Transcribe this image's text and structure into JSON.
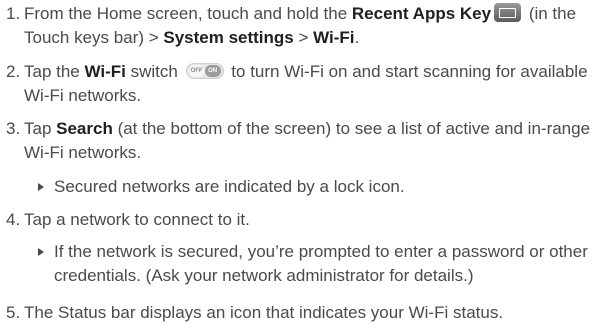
{
  "steps": [
    {
      "number": "1.",
      "t1": "From the Home screen, touch and hold the ",
      "b1": "Recent Apps Key",
      "t2": " (in the Touch keys bar) > ",
      "b2": "System settings",
      "t3": " > ",
      "b3": "Wi-Fi",
      "t4": "."
    },
    {
      "number": "2.",
      "t1": "Tap the ",
      "b1": "Wi-Fi",
      "t2": " switch ",
      "switch_off": "OFF",
      "switch_on": "ON",
      "t3": " to turn Wi-Fi on and start scanning for available Wi-Fi networks."
    },
    {
      "number": "3.",
      "t1": "Tap ",
      "b1": "Search",
      "t2": " (at the bottom of the screen) to see a list of active and in-range Wi-Fi networks.",
      "bullet": "Secured networks are indicated by a lock icon."
    },
    {
      "number": "4.",
      "t1": "Tap a network to connect to it.",
      "bullet": "If the network is secured, you’re prompted to enter a password or other credentials. (Ask your network administrator for details.)"
    },
    {
      "number": "5.",
      "t1": "The Status bar displays an icon that indicates your Wi-Fi status."
    }
  ],
  "icons": {
    "recent_apps": "recent-apps-key-icon",
    "wifi_switch": "wifi-switch-icon",
    "bullet": "triangle-bullet-icon"
  }
}
